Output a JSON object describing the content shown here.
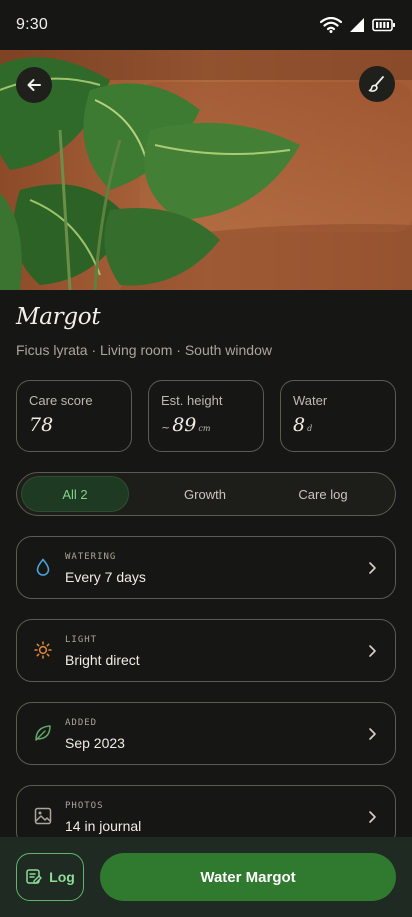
{
  "status": {
    "time": "9:30"
  },
  "plant": {
    "name": "Margot",
    "subtitle": "Ficus lyrata · Living room · South window"
  },
  "stats": [
    {
      "label": "Care score",
      "prefix": "",
      "value": "78",
      "unit": ""
    },
    {
      "label": "Est. height",
      "prefix": "~",
      "value": "89",
      "unit": "cm"
    },
    {
      "label": "Water",
      "prefix": "",
      "value": "8",
      "unit": "d"
    }
  ],
  "tabs": [
    {
      "label": "All 2",
      "active": true
    },
    {
      "label": "Growth",
      "active": false
    },
    {
      "label": "Care log",
      "active": false
    }
  ],
  "cards": [
    {
      "kicker": "WATERING",
      "value": "Every 7 days",
      "icon": "water-drop-icon",
      "color": "#4aa3d8"
    },
    {
      "kicker": "LIGHT",
      "value": "Bright direct",
      "icon": "sun-icon",
      "color": "#e08a3a"
    },
    {
      "kicker": "ADDED",
      "value": "Sep 2023",
      "icon": "leaf-icon",
      "color": "#5fa865"
    },
    {
      "kicker": "PHOTOS",
      "value": "14 in journal",
      "icon": "image-icon",
      "color": "#a9a69d"
    }
  ],
  "actions": {
    "log_label": "Log",
    "water_label": "Water Margot"
  },
  "colors": {
    "background": "#161614",
    "accent": "#2f7a2e",
    "accent_light": "#8fdb98"
  }
}
